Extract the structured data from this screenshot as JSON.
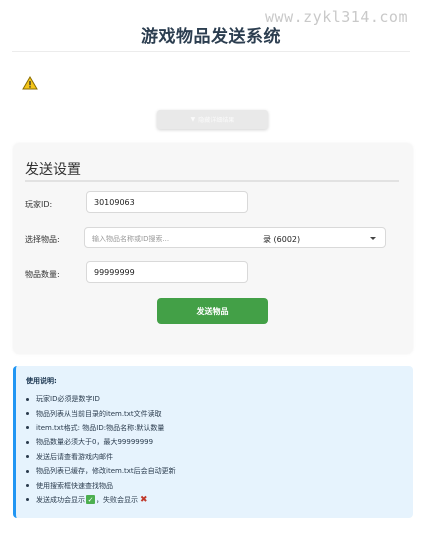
{
  "header": {
    "title": "游戏物品发送系统",
    "watermark": "www.zykl314.com"
  },
  "warning_icon": "warning-triangle-icon",
  "toggle_button": {
    "icon": "chevron-down",
    "label": "隐藏详细结果"
  },
  "form": {
    "title": "发送设置",
    "player_label": "玩家ID:",
    "player_value": "30109063",
    "item_label": "选择物品:",
    "search_placeholder": "输入物品名称或ID搜索...",
    "item_value": "录 (6002)",
    "quantity_label": "物品数量:",
    "quantity_value": "99999999",
    "send_label": "发送物品"
  },
  "instructions": {
    "title": "使用说明:",
    "items": [
      "玩家ID必须是数字ID",
      "物品列表从当前目录的item.txt文件读取",
      "item.txt格式: 物品ID:物品名称:默认数量",
      "物品数量必须大于0，最大99999999",
      "发送后请查看游戏内邮件",
      "物品列表已缓存，修改item.txt后会自动更新",
      "使用搜索框快速查找物品"
    ],
    "last_prefix": "发送成功会显示",
    "last_middle": "，失败会显示",
    "check_glyph": "✓",
    "cross_glyph": "✖"
  },
  "colors": {
    "send_button": "#43a047",
    "info_border": "#2196f3",
    "info_bg": "#e6f3fd",
    "warning": "#f5c518"
  }
}
